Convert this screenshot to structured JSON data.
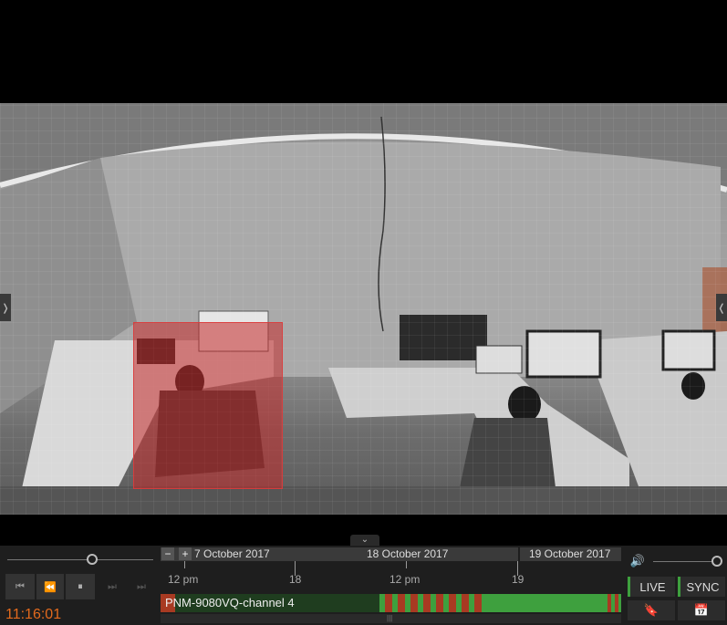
{
  "camera": {
    "name": "PNM-9080VQ-channel 4",
    "motion_zone_color": "#c42a2a"
  },
  "player": {
    "time": "11:16:01",
    "speed_slider_level": 0.58,
    "volume_slider_level": 1.0
  },
  "timeline": {
    "dates": [
      "7 October 2017",
      "18 October 2017",
      "19 October 2017"
    ],
    "ticks": [
      "12 pm",
      "18",
      "12 pm",
      "19"
    ],
    "zoom_out": "−",
    "zoom_in": "+"
  },
  "buttons": {
    "live": "LIVE",
    "sync": "SYNC"
  },
  "colors": {
    "accent": "#e36a1d",
    "recording_green": "#3ea03e",
    "recording_red": "#a83a22"
  }
}
